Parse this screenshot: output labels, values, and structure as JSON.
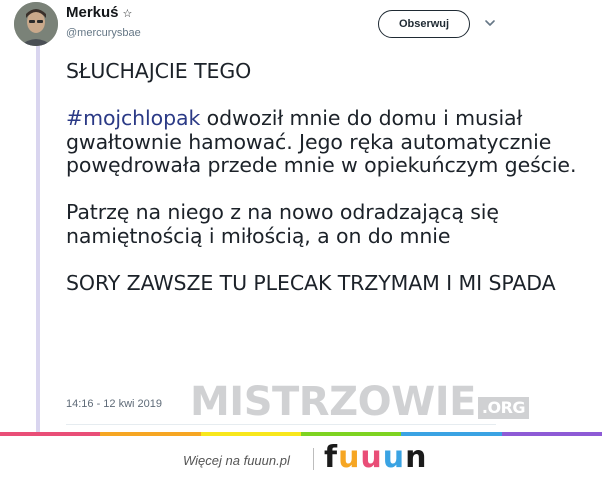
{
  "author": {
    "name": "Merkuś",
    "badge": "☆",
    "handle": "@mercurysbae"
  },
  "header": {
    "follow_label": "Obserwuj",
    "menu_icon": "chevron-down-icon"
  },
  "tweet": {
    "line1": "SŁUCHAJCIE TEGO",
    "hashtag": "#mojchlopak",
    "para2_rest": " odwoził mnie do domu i musiał gwałtownie hamować. Jego ręka automatycznie powędrowała przede mnie w opiekuńczym geście.",
    "para3": "Patrzę na niego z na nowo odradzającą się namiętnością i miłością, a on do mnie",
    "para4": "SORY ZAWSZE TU PLECAK TRZYMAM I MI SPADA",
    "timestamp": "14:16 - 12 kwi 2019"
  },
  "watermark": {
    "text": "MISTRZOWIE",
    "suffix": ".ORG"
  },
  "footer": {
    "link_text": "Więcej na fuuun.pl",
    "logo_letters": [
      "f",
      "u",
      "u",
      "u",
      "n"
    ],
    "logo_colors": [
      "#1b1b1b",
      "#f6a623",
      "#e94e77",
      "#3aa3e3",
      "#1b1b1b"
    ]
  },
  "colors": {
    "hashtag": "#2b3a86",
    "text": "#1c2229",
    "rainbow": [
      "#e94e77",
      "#f6a623",
      "#f8e71c",
      "#7ed321",
      "#3aa3e3",
      "#8e5bd6"
    ]
  }
}
